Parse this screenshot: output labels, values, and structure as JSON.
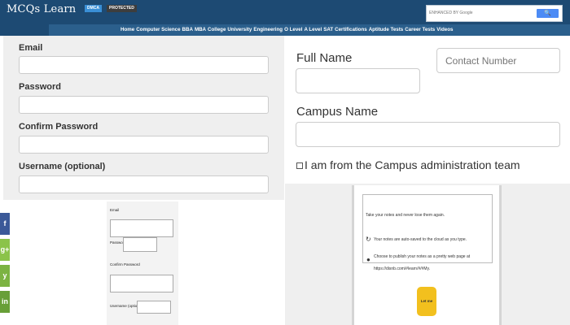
{
  "header": {
    "logo": "MCQs Learn",
    "badge_dmca": "DMCA",
    "badge_protected": "PROTECTED",
    "search_placeholder": "ENHANCED BY Google",
    "search_button_glyph": "🔍",
    "nav": [
      "Home",
      "Computer Science",
      "BBA",
      "MBA",
      "College",
      "University",
      "Engineering",
      "O Level",
      "A Level",
      "SAT",
      "Certifications",
      "Aptitude Tests",
      "Career Tests",
      "Videos"
    ]
  },
  "signup_form": {
    "email_label": "Email",
    "password_label": "Password",
    "confirm_password_label": "Confirm Password",
    "username_label": "Username (optional)"
  },
  "campus_form": {
    "full_name_label": "Full Name",
    "contact_number_placeholder": "Contact Number",
    "campus_name_label": "Campus Name",
    "admin_checkbox_label": "I am from the Campus administration team"
  },
  "notes_promo": {
    "line1": "Take your notes and never lose them again.",
    "line2": "Your notes are auto-saved to the cloud as you type.",
    "line3": "Choose to publish your notes as a pretty web page at",
    "line4": "https://disnb.com/#learn/#/#My.",
    "cta_label": "Let me type!"
  },
  "small_form": {
    "email_label": "Email",
    "password_label": "Password",
    "confirm_password_label": "Confirm Password",
    "username_label": "Username (optional)"
  },
  "social": {
    "facebook": "f",
    "google_plus": "g+",
    "twitter": "y",
    "linkedin": "in"
  },
  "colors": {
    "header_bg": "#1d4a73",
    "facebook": "#3b5998",
    "google_plus": "#8bc34a",
    "twitter": "#7cb342",
    "linkedin": "#689f38",
    "cta": "#f2c01e"
  }
}
